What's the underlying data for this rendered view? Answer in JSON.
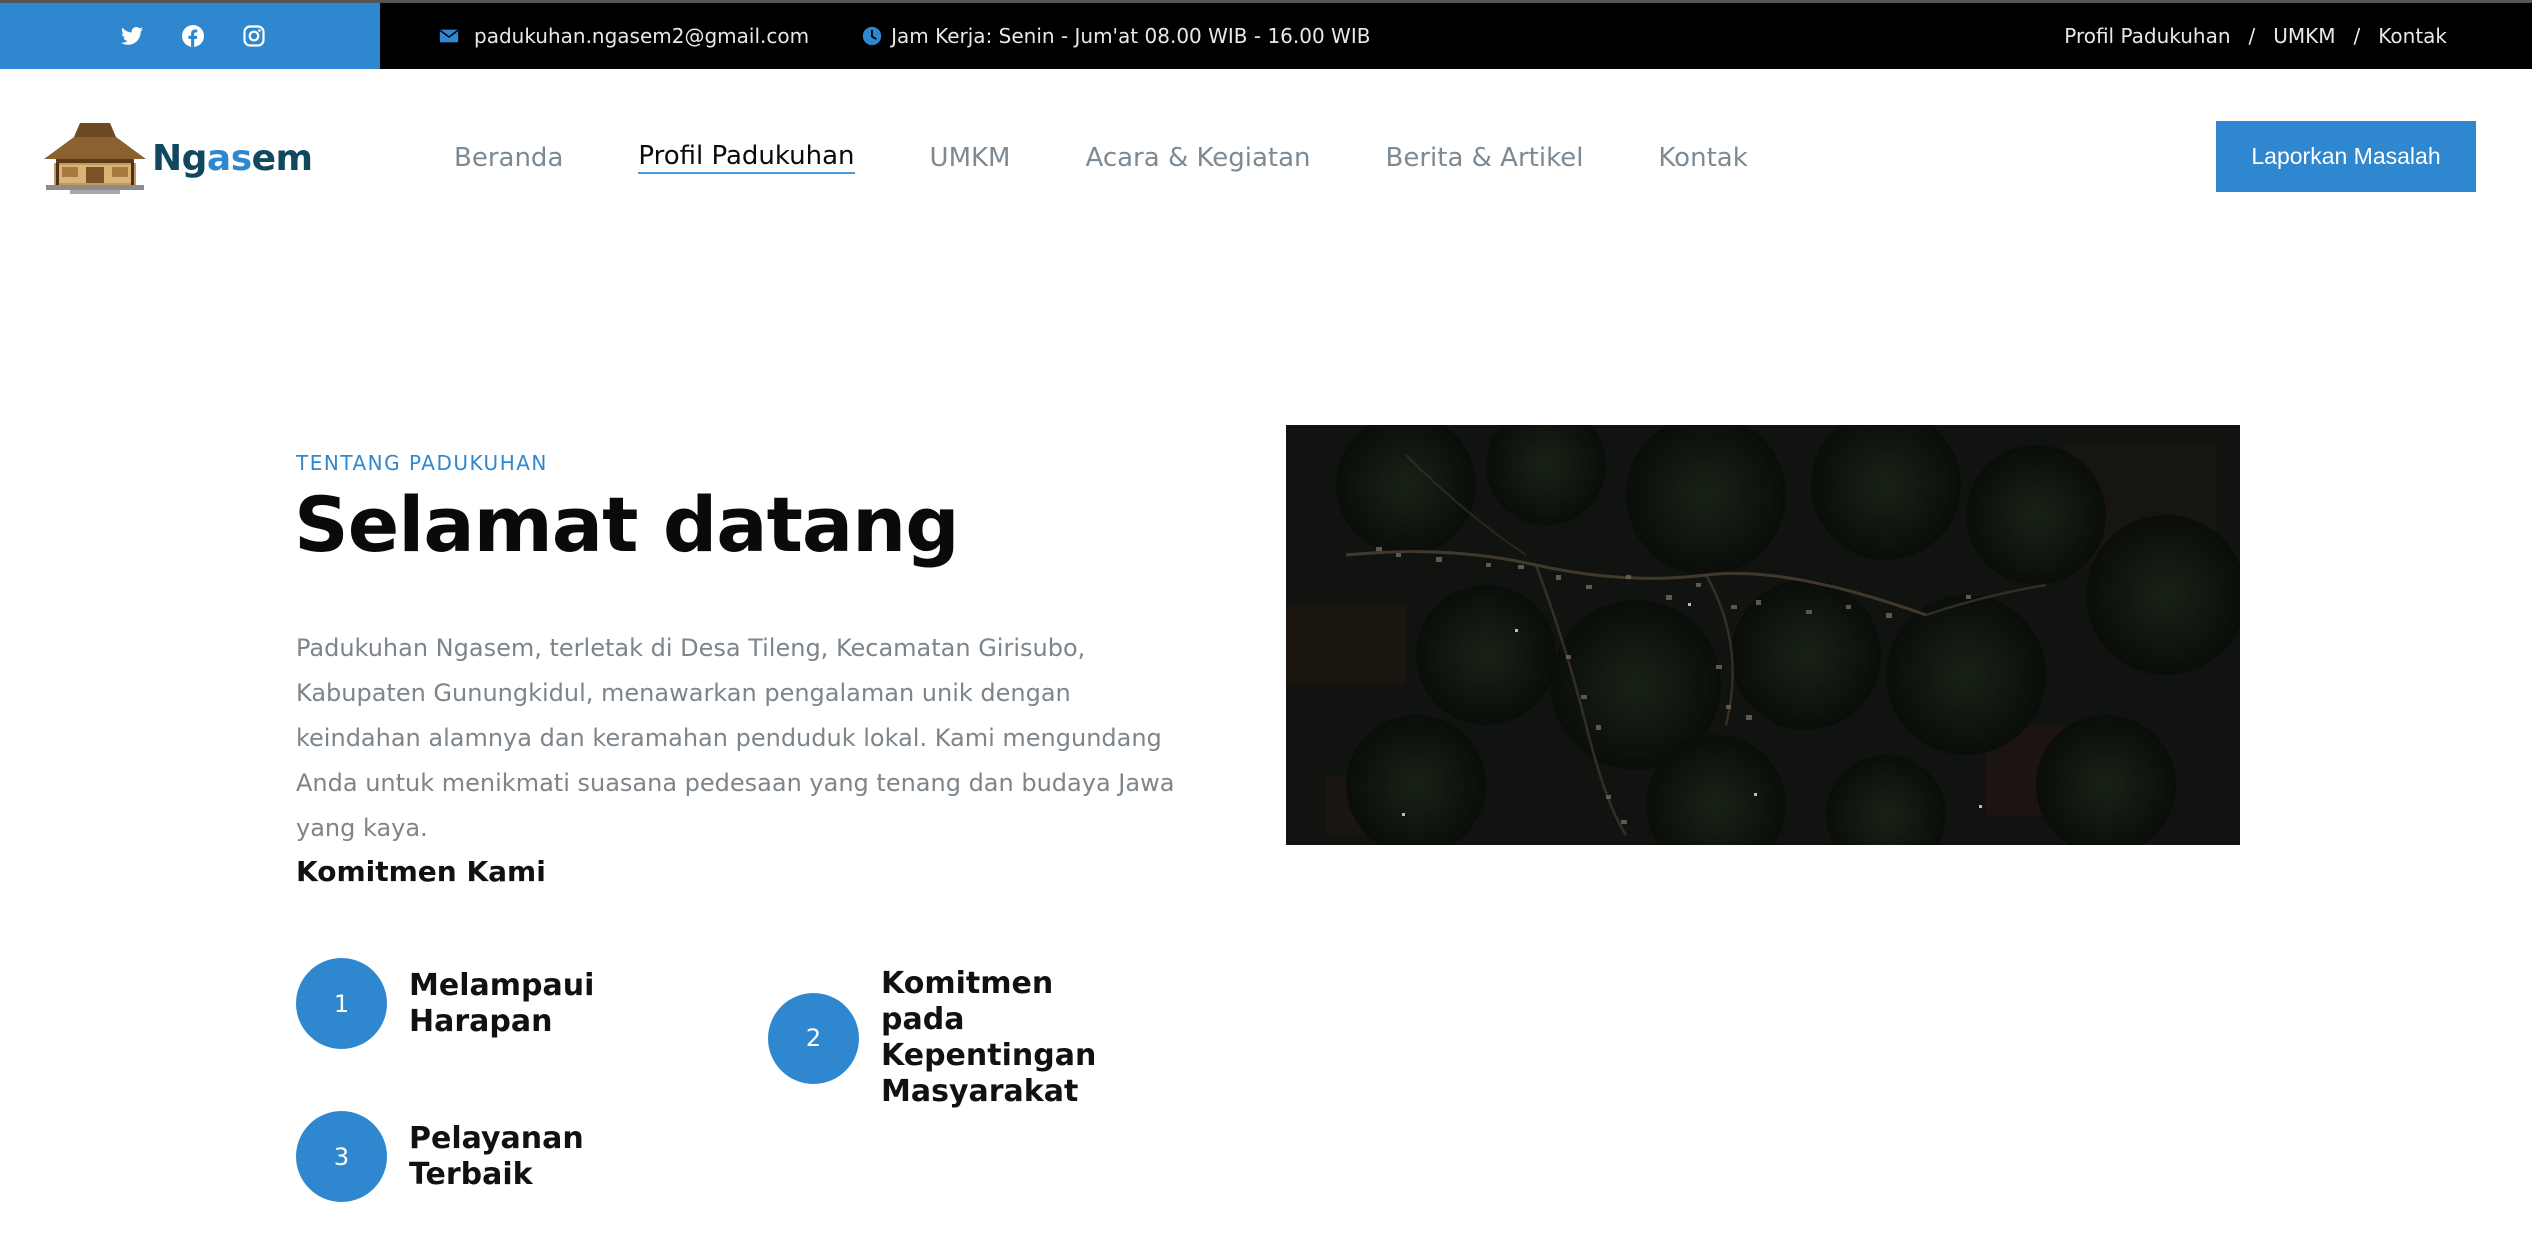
{
  "topbar": {
    "social": [
      {
        "icon": "twitter-icon"
      },
      {
        "icon": "facebook-icon"
      },
      {
        "icon": "instagram-icon"
      }
    ],
    "email": "padukuhan.ngasem2@gmail.com",
    "hours": "Jam Kerja: Senin - Jum'at 08.00 WIB - 16.00 WIB",
    "links": [
      "Profil Padukuhan",
      "UMKM",
      "Kontak"
    ],
    "separator": "/"
  },
  "header": {
    "logo_text_1": "Ng",
    "logo_text_2": "as",
    "logo_text_3": "em",
    "nav": [
      "Beranda",
      "Profil Padukuhan",
      "UMKM",
      "Acara & Kegiatan",
      "Berita & Artikel",
      "Kontak"
    ],
    "active_nav": "Profil Padukuhan",
    "cta_label": "Laporkan Masalah"
  },
  "about": {
    "eyebrow": "TENTANG PADUKUHAN",
    "title": "Selamat datang",
    "description": "Padukuhan Ngasem, terletak di Desa Tileng, Kecamatan Girisubo, Kabupaten Gunungkidul, menawarkan pengalaman unik dengan keindahan alamnya dan keramahan penduduk lokal. Kami mengundang Anda untuk menikmati suasana pedesaan yang tenang dan budaya Jawa yang kaya.",
    "commitment_title": "Komitmen Kami",
    "commitments": [
      {
        "number": "1",
        "label": "Melampaui Harapan"
      },
      {
        "number": "2",
        "label": "Komitmen pada Kepentingan Masyarakat"
      },
      {
        "number": "3",
        "label": "Pelayanan Terbaik"
      }
    ]
  },
  "colors": {
    "accent": "#2f88cf",
    "topbar_bg": "#000000",
    "logo_dark": "#10495f",
    "nav_text": "#7d8a94"
  }
}
